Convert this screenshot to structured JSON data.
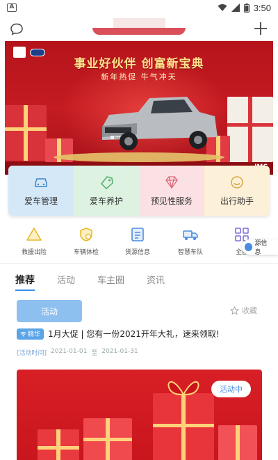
{
  "status_bar": {
    "app_icon_letter": "A",
    "time": "3:50"
  },
  "banner": {
    "title": "事业好伙伴 创富新宝典",
    "subtitle": "新年热促 牛气冲天",
    "plate_text": "凯运尊",
    "brand_text": "JMC"
  },
  "services": [
    {
      "label": "爱车管理",
      "icon": "car-icon",
      "bg": "#d5e8f8",
      "color": "#3d84c6"
    },
    {
      "label": "爱车养护",
      "icon": "tag-icon",
      "bg": "#ddf2e1",
      "color": "#4fae6a"
    },
    {
      "label": "预见性服务",
      "icon": "diamond-icon",
      "bg": "#fbe1e3",
      "color": "#d9697a"
    },
    {
      "label": "出行助手",
      "icon": "smile-icon",
      "bg": "#fcf0d8",
      "color": "#d8a640"
    }
  ],
  "quick_links": [
    {
      "label": "救援出险",
      "icon": "warning-triangle-icon",
      "color": "#e8b830"
    },
    {
      "label": "车辆体检",
      "icon": "shield-check-icon",
      "color": "#e8b830"
    },
    {
      "label": "货源信息",
      "icon": "document-icon",
      "color": "#4a8de0"
    },
    {
      "label": "智慧车队",
      "icon": "truck-icon",
      "color": "#4a8de0"
    },
    {
      "label": "全部",
      "icon": "grid-icon",
      "color": "#7b6fd8"
    }
  ],
  "floating_chip": {
    "label": "源信息"
  },
  "tabs": [
    {
      "label": "推荐",
      "active": true
    },
    {
      "label": "活动",
      "active": false
    },
    {
      "label": "车主圈",
      "active": false
    },
    {
      "label": "资讯",
      "active": false
    }
  ],
  "post": {
    "category_button": "活动",
    "favorite_label": "收藏",
    "badge": "精华",
    "title": "1月大促 | 您有一份2021开年大礼，速来领取!",
    "time_label": "[活动时间]",
    "start_date": "2021-01-01",
    "date_separator": "至",
    "end_date": "2021-01-31",
    "status": "活动中"
  }
}
